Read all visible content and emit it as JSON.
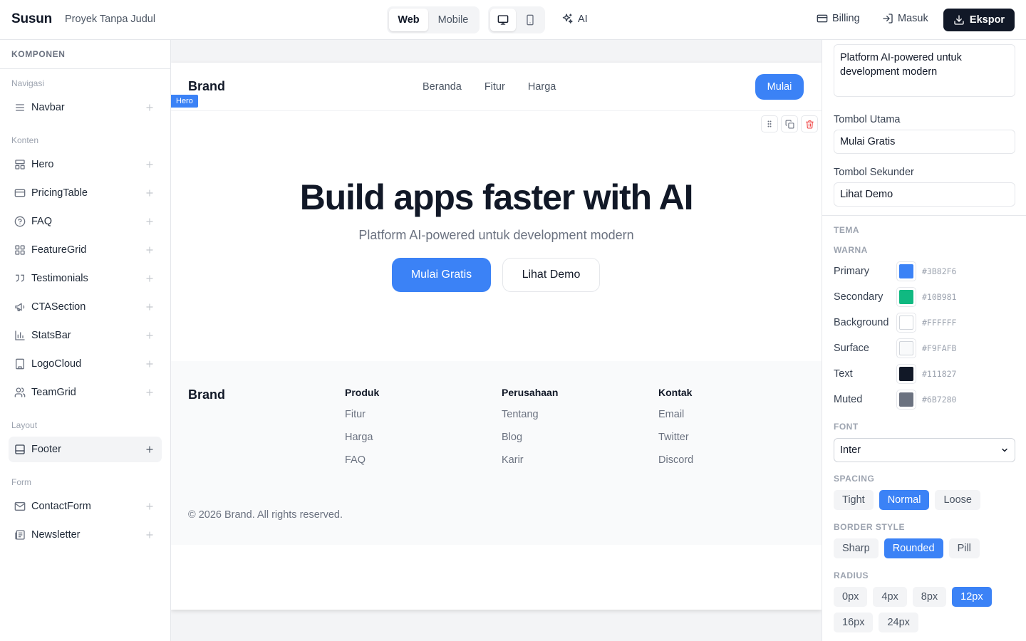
{
  "topbar": {
    "logo": "Susun",
    "project_name": "Proyek Tanpa Judul",
    "view_modes": [
      "Web",
      "Mobile"
    ],
    "active_view": "Web",
    "device_icons": [
      "desktop-icon",
      "mobile-icon"
    ],
    "ai_label": "AI",
    "billing_label": "Billing",
    "login_label": "Masuk",
    "export_label": "Ekspor"
  },
  "sidebar": {
    "heading": "KOMPONEN",
    "categories": {
      "navigation": "Navigasi",
      "content": "Konten",
      "layout": "Layout",
      "form": "Form"
    },
    "items": [
      {
        "label": "Navbar",
        "icon": "menu-icon"
      },
      {
        "label": "Hero",
        "icon": "layout-icon"
      },
      {
        "label": "PricingTable",
        "icon": "credit-card-icon"
      },
      {
        "label": "FAQ",
        "icon": "help-circle-icon"
      },
      {
        "label": "FeatureGrid",
        "icon": "grid-icon"
      },
      {
        "label": "Testimonials",
        "icon": "quote-icon"
      },
      {
        "label": "CTASection",
        "icon": "megaphone-icon"
      },
      {
        "label": "StatsBar",
        "icon": "bar-chart-icon"
      },
      {
        "label": "LogoCloud",
        "icon": "building-icon"
      },
      {
        "label": "TeamGrid",
        "icon": "users-icon"
      },
      {
        "label": "Footer",
        "icon": "panel-bottom-icon",
        "active": true
      },
      {
        "label": "ContactForm",
        "icon": "mail-icon"
      },
      {
        "label": "Newsletter",
        "icon": "newspaper-icon"
      }
    ]
  },
  "canvas": {
    "nav": {
      "brand": "Brand",
      "links": [
        "Beranda",
        "Fitur",
        "Harga"
      ],
      "cta": "Mulai"
    },
    "hero": {
      "tag": "Hero",
      "title": "Build apps faster with AI",
      "subtitle": "Platform AI-powered untuk development modern",
      "primary_button": "Mulai Gratis",
      "secondary_button": "Lihat Demo"
    },
    "footer": {
      "brand": "Brand",
      "columns": [
        {
          "heading": "Produk",
          "links": [
            "Fitur",
            "Harga",
            "FAQ"
          ]
        },
        {
          "heading": "Perusahaan",
          "links": [
            "Tentang",
            "Blog",
            "Karir"
          ]
        },
        {
          "heading": "Kontak",
          "links": [
            "Email",
            "Twitter",
            "Discord"
          ]
        }
      ],
      "copyright": "© 2026 Brand. All rights reserved."
    }
  },
  "panel": {
    "subtitle_value": "Platform AI-powered untuk development modern",
    "primary_button_label": "Tombol Utama",
    "primary_button_value": "Mulai Gratis",
    "secondary_button_label": "Tombol Sekunder",
    "secondary_button_value": "Lihat Demo",
    "theme_heading": "TEMA",
    "colors_heading": "WARNA",
    "colors": [
      {
        "name": "Primary",
        "hex": "#3B82F6"
      },
      {
        "name": "Secondary",
        "hex": "#10B981"
      },
      {
        "name": "Background",
        "hex": "#FFFFFF"
      },
      {
        "name": "Surface",
        "hex": "#F9FAFB"
      },
      {
        "name": "Text",
        "hex": "#111827"
      },
      {
        "name": "Muted",
        "hex": "#6B7280"
      }
    ],
    "font_heading": "FONT",
    "font_value": "Inter",
    "spacing_heading": "SPACING",
    "spacing_options": [
      "Tight",
      "Normal",
      "Loose"
    ],
    "spacing_active": "Normal",
    "border_heading": "BORDER STYLE",
    "border_options": [
      "Sharp",
      "Rounded",
      "Pill"
    ],
    "border_active": "Rounded",
    "radius_heading": "RADIUS",
    "radius_options": [
      "0px",
      "4px",
      "8px",
      "12px",
      "16px",
      "24px"
    ],
    "radius_active": "12px"
  }
}
